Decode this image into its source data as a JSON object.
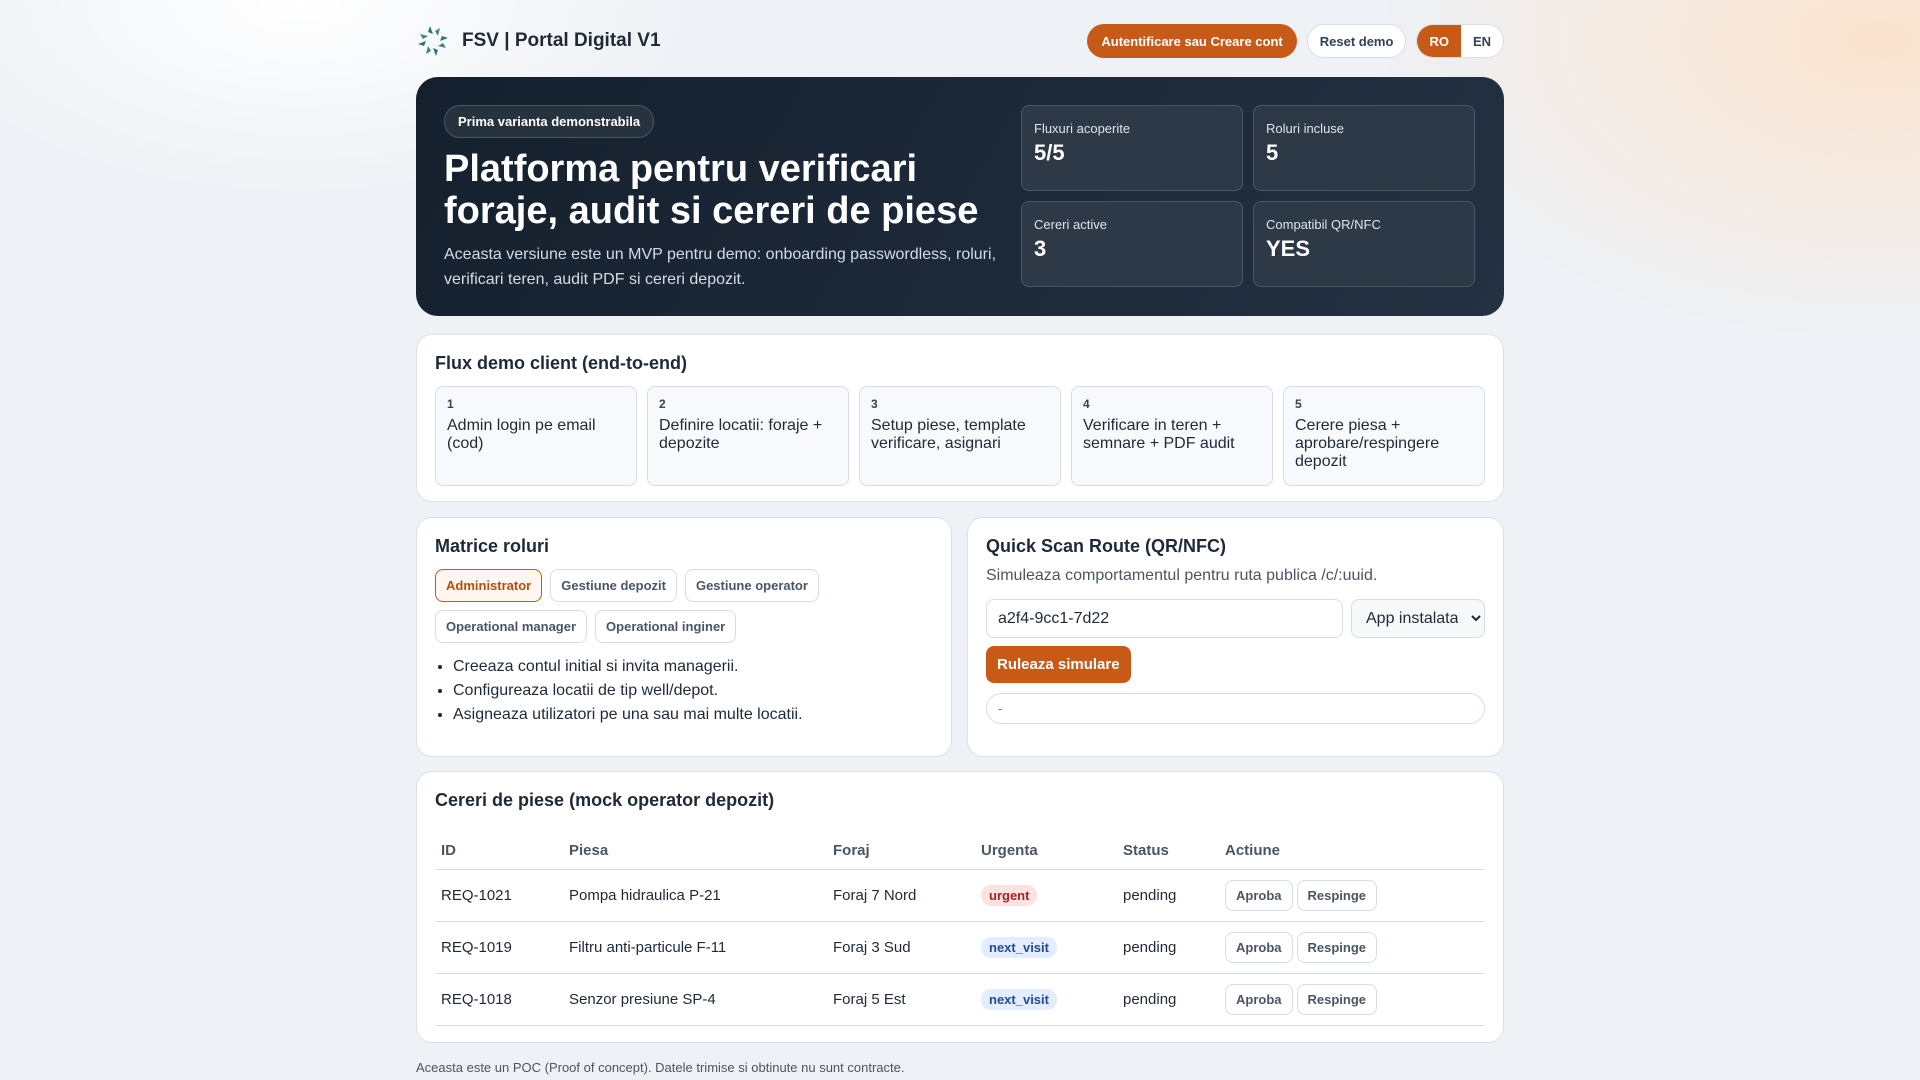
{
  "header": {
    "title": "FSV | Portal Digital V1",
    "auth_label": "Autentificare sau Creare cont",
    "reset_label": "Reset demo",
    "lang": [
      "RO",
      "EN"
    ]
  },
  "hero": {
    "badge": "Prima varianta demonstrabila",
    "title": "Platforma pentru verificari foraje, audit si cereri de piese",
    "desc": "Aceasta versiune este un MVP pentru demo: onboarding passwordless, roluri, verificari teren, audit PDF si cereri depozit.",
    "stats": [
      {
        "label": "Fluxuri acoperite",
        "value": "5/5"
      },
      {
        "label": "Roluri incluse",
        "value": "5"
      },
      {
        "label": "Cereri active",
        "value": "3"
      },
      {
        "label": "Compatibil QR/NFC",
        "value": "YES"
      }
    ]
  },
  "flow": {
    "title": "Flux demo client (end-to-end)",
    "steps": [
      {
        "n": "1",
        "t": "Admin login pe email (cod)"
      },
      {
        "n": "2",
        "t": "Definire locatii: foraje + depozite"
      },
      {
        "n": "3",
        "t": "Setup piese, template verificare, asignari"
      },
      {
        "n": "4",
        "t": "Verificare in teren + semnare + PDF audit"
      },
      {
        "n": "5",
        "t": "Cerere piesa + aprobare/respingere depozit"
      }
    ]
  },
  "roles": {
    "title": "Matrice roluri",
    "chips": [
      "Administrator",
      "Gestiune depozit",
      "Gestiune operator",
      "Operational manager",
      "Operational inginer"
    ],
    "bullets": [
      "Creeaza contul initial si invita managerii.",
      "Configureaza locatii de tip well/depot.",
      "Asigneaza utilizatori pe una sau mai multe locatii."
    ]
  },
  "scan": {
    "title": "Quick Scan Route (QR/NFC)",
    "subtitle": "Simuleaza comportamentul pentru ruta publica /c/:uuid.",
    "input_value": "a2f4-9cc1-7d22",
    "select_value": "App instalata",
    "run_label": "Ruleaza simulare",
    "output": "-"
  },
  "requests": {
    "title": "Cereri de piese (mock operator depozit)",
    "columns": [
      "ID",
      "Piesa",
      "Foraj",
      "Urgenta",
      "Status",
      "Actiune"
    ],
    "approve_label": "Aproba",
    "reject_label": "Respinge",
    "rows": [
      {
        "id": "REQ-1021",
        "piesa": "Pompa hidraulica P-21",
        "foraj": "Foraj 7 Nord",
        "urgenta": "urgent",
        "status": "pending"
      },
      {
        "id": "REQ-1019",
        "piesa": "Filtru anti-particule F-11",
        "foraj": "Foraj 3 Sud",
        "urgenta": "next_visit",
        "status": "pending"
      },
      {
        "id": "REQ-1018",
        "piesa": "Senzor presiune SP-4",
        "foraj": "Foraj 5 Est",
        "urgenta": "next_visit",
        "status": "pending"
      }
    ]
  },
  "footer": "Aceasta este un POC (Proof of concept). Datele trimise si obtinute nu sunt contracte.",
  "colors": {
    "accent": "#c85a17",
    "hero_bg": "#1b2533"
  }
}
